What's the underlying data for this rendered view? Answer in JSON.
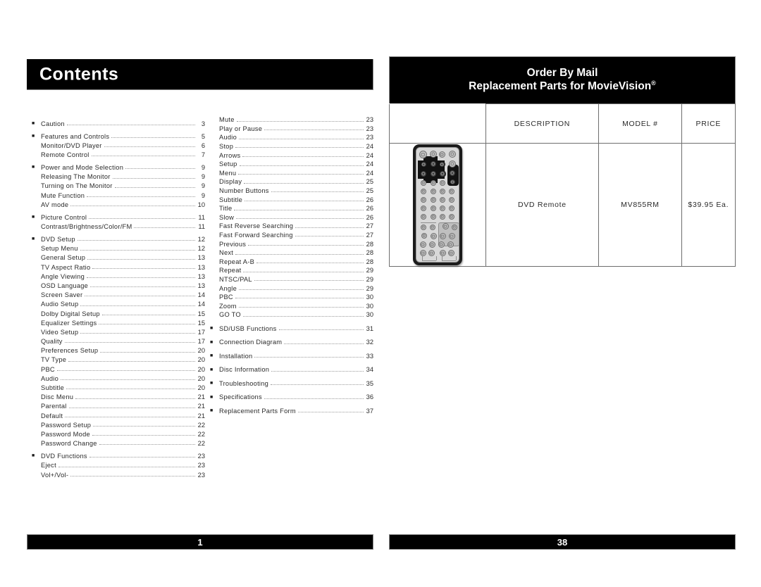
{
  "left_page": {
    "title": "Contents",
    "footer_page_number": "1",
    "toc_left_column": [
      {
        "bullet": true,
        "label": "Caution",
        "page": "3"
      },
      {
        "bullet": true,
        "label": "Features and Controls",
        "page": "5"
      },
      {
        "bullet": false,
        "label": "Monitor/DVD Player",
        "page": "6"
      },
      {
        "bullet": false,
        "label": "Remote Control",
        "page": "7"
      },
      {
        "bullet": true,
        "label": "Power and Mode Selection",
        "page": "9"
      },
      {
        "bullet": false,
        "label": "Releasing The Monitor",
        "page": "9"
      },
      {
        "bullet": false,
        "label": "Turning on The Monitor",
        "page": "9"
      },
      {
        "bullet": false,
        "label": "Mute Function",
        "page": "9"
      },
      {
        "bullet": false,
        "label": "AV mode",
        "page": "10"
      },
      {
        "bullet": true,
        "label": "Picture Control",
        "page": "11"
      },
      {
        "bullet": false,
        "label": "Contrast/Brightness/Color/FM",
        "page": "11"
      },
      {
        "bullet": true,
        "label": "DVD Setup",
        "page": "12"
      },
      {
        "bullet": false,
        "label": "Setup Menu",
        "page": "12"
      },
      {
        "bullet": false,
        "label": "General Setup",
        "page": "13"
      },
      {
        "bullet": false,
        "label": "TV Aspect Ratio",
        "page": "13"
      },
      {
        "bullet": false,
        "label": "Angle Viewing",
        "page": "13"
      },
      {
        "bullet": false,
        "label": "OSD Language",
        "page": "13"
      },
      {
        "bullet": false,
        "label": "Screen Saver",
        "page": "14"
      },
      {
        "bullet": false,
        "label": "Audio Setup",
        "page": "14"
      },
      {
        "bullet": false,
        "label": "Dolby Digital Setup",
        "page": "15"
      },
      {
        "bullet": false,
        "label": "Equalizer Settings",
        "page": "15"
      },
      {
        "bullet": false,
        "label": "Video Setup",
        "page": "17"
      },
      {
        "bullet": false,
        "label": "Quality",
        "page": "17"
      },
      {
        "bullet": false,
        "label": "Preferences Setup",
        "page": "20"
      },
      {
        "bullet": false,
        "label": "TV Type",
        "page": "20"
      },
      {
        "bullet": false,
        "label": "PBC",
        "page": "20"
      },
      {
        "bullet": false,
        "label": "Audio",
        "page": "20"
      },
      {
        "bullet": false,
        "label": "Subtitle",
        "page": "20"
      },
      {
        "bullet": false,
        "label": "Disc Menu",
        "page": "21"
      },
      {
        "bullet": false,
        "label": "Parental",
        "page": "21"
      },
      {
        "bullet": false,
        "label": "Default",
        "page": "21"
      },
      {
        "bullet": false,
        "label": "Password Setup",
        "page": "22"
      },
      {
        "bullet": false,
        "label": "Password Mode",
        "page": "22"
      },
      {
        "bullet": false,
        "label": "Password Change",
        "page": "22"
      },
      {
        "bullet": true,
        "label": "DVD Functions",
        "page": "23"
      },
      {
        "bullet": false,
        "label": "Eject",
        "page": "23"
      },
      {
        "bullet": false,
        "label": "Vol+/Vol-",
        "page": "23"
      }
    ],
    "toc_right_column": [
      {
        "bullet": false,
        "label": "Mute",
        "page": "23"
      },
      {
        "bullet": false,
        "label": "Play or Pause",
        "page": "23"
      },
      {
        "bullet": false,
        "label": "Audio",
        "page": "23"
      },
      {
        "bullet": false,
        "label": "Stop",
        "page": "24"
      },
      {
        "bullet": false,
        "label": "Arrows",
        "page": "24"
      },
      {
        "bullet": false,
        "label": "Setup",
        "page": "24"
      },
      {
        "bullet": false,
        "label": "Menu",
        "page": "24"
      },
      {
        "bullet": false,
        "label": "Display",
        "page": "25"
      },
      {
        "bullet": false,
        "label": "Number Buttons",
        "page": "25"
      },
      {
        "bullet": false,
        "label": "Subtitle",
        "page": "26"
      },
      {
        "bullet": false,
        "label": "Title",
        "page": "26"
      },
      {
        "bullet": false,
        "label": "Slow",
        "page": "26"
      },
      {
        "bullet": false,
        "label": "Fast Reverse Searching",
        "page": "27"
      },
      {
        "bullet": false,
        "label": "Fast Forward Searching",
        "page": "27"
      },
      {
        "bullet": false,
        "label": "Previous",
        "page": "28"
      },
      {
        "bullet": false,
        "label": "Next",
        "page": "28"
      },
      {
        "bullet": false,
        "label": "Repeat A-B",
        "page": "28"
      },
      {
        "bullet": false,
        "label": "Repeat",
        "page": "29"
      },
      {
        "bullet": false,
        "label": "NTSC/PAL",
        "page": "29"
      },
      {
        "bullet": false,
        "label": "Angle",
        "page": "29"
      },
      {
        "bullet": false,
        "label": "PBC",
        "page": "30"
      },
      {
        "bullet": false,
        "label": "Zoom",
        "page": "30"
      },
      {
        "bullet": false,
        "label": "GO TO",
        "page": "30"
      },
      {
        "bullet": true,
        "label": "SD/USB Functions",
        "page": "31"
      },
      {
        "bullet": true,
        "label": "Connection Diagram",
        "page": "32"
      },
      {
        "bullet": true,
        "label": "Installation",
        "page": "33"
      },
      {
        "bullet": true,
        "label": "Disc Information",
        "page": "34"
      },
      {
        "bullet": true,
        "label": "Troubleshooting",
        "page": "35"
      },
      {
        "bullet": true,
        "label": "Specifications",
        "page": "36"
      },
      {
        "bullet": true,
        "label": "Replacement Parts Form",
        "page": "37"
      }
    ]
  },
  "right_page": {
    "header_line1": "Order By Mail",
    "header_line2": "Replacement Parts for MovieVision",
    "header_line2_sup": "®",
    "footer_page_number": "38",
    "table": {
      "columns": [
        "",
        "DESCRIPTION",
        "MODEL #",
        "PRICE"
      ],
      "rows": [
        {
          "image": "dvd-remote-illustration",
          "description": "DVD Remote",
          "model": "MV855RM",
          "price": "$39.95 Ea."
        }
      ]
    }
  },
  "colors": {
    "bar_background": "#000000",
    "bar_text": "#ffffff",
    "body_text": "#2b2b2b",
    "table_border": "#6e6e6e",
    "leader_dots": "#9b9b9b"
  }
}
